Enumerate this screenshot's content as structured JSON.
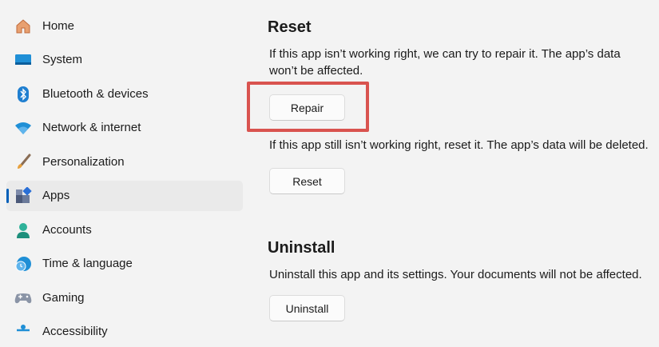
{
  "sidebar": {
    "items": [
      {
        "label": "Home",
        "icon": "home-icon",
        "selected": false
      },
      {
        "label": "System",
        "icon": "system-icon",
        "selected": false
      },
      {
        "label": "Bluetooth & devices",
        "icon": "bluetooth-icon",
        "selected": false
      },
      {
        "label": "Network & internet",
        "icon": "wifi-icon",
        "selected": false
      },
      {
        "label": "Personalization",
        "icon": "brush-icon",
        "selected": false
      },
      {
        "label": "Apps",
        "icon": "apps-icon",
        "selected": true
      },
      {
        "label": "Accounts",
        "icon": "account-icon",
        "selected": false
      },
      {
        "label": "Time & language",
        "icon": "clock-globe-icon",
        "selected": false
      },
      {
        "label": "Gaming",
        "icon": "gamepad-icon",
        "selected": false
      },
      {
        "label": "Accessibility",
        "icon": "accessibility-icon",
        "selected": false
      }
    ]
  },
  "reset": {
    "title": "Reset",
    "repair_description": "If this app isn’t working right, we can try to repair it. The app’s data won’t be affected.",
    "repair_button": "Repair",
    "reset_description": "If this app still isn’t working right, reset it. The app’s data will be deleted.",
    "reset_button": "Reset"
  },
  "uninstall": {
    "title": "Uninstall",
    "description": "Uninstall this app and its settings. Your documents will not be affected.",
    "button": "Uninstall"
  },
  "colors": {
    "accent": "#005fb8",
    "highlight": "#d9534f"
  }
}
